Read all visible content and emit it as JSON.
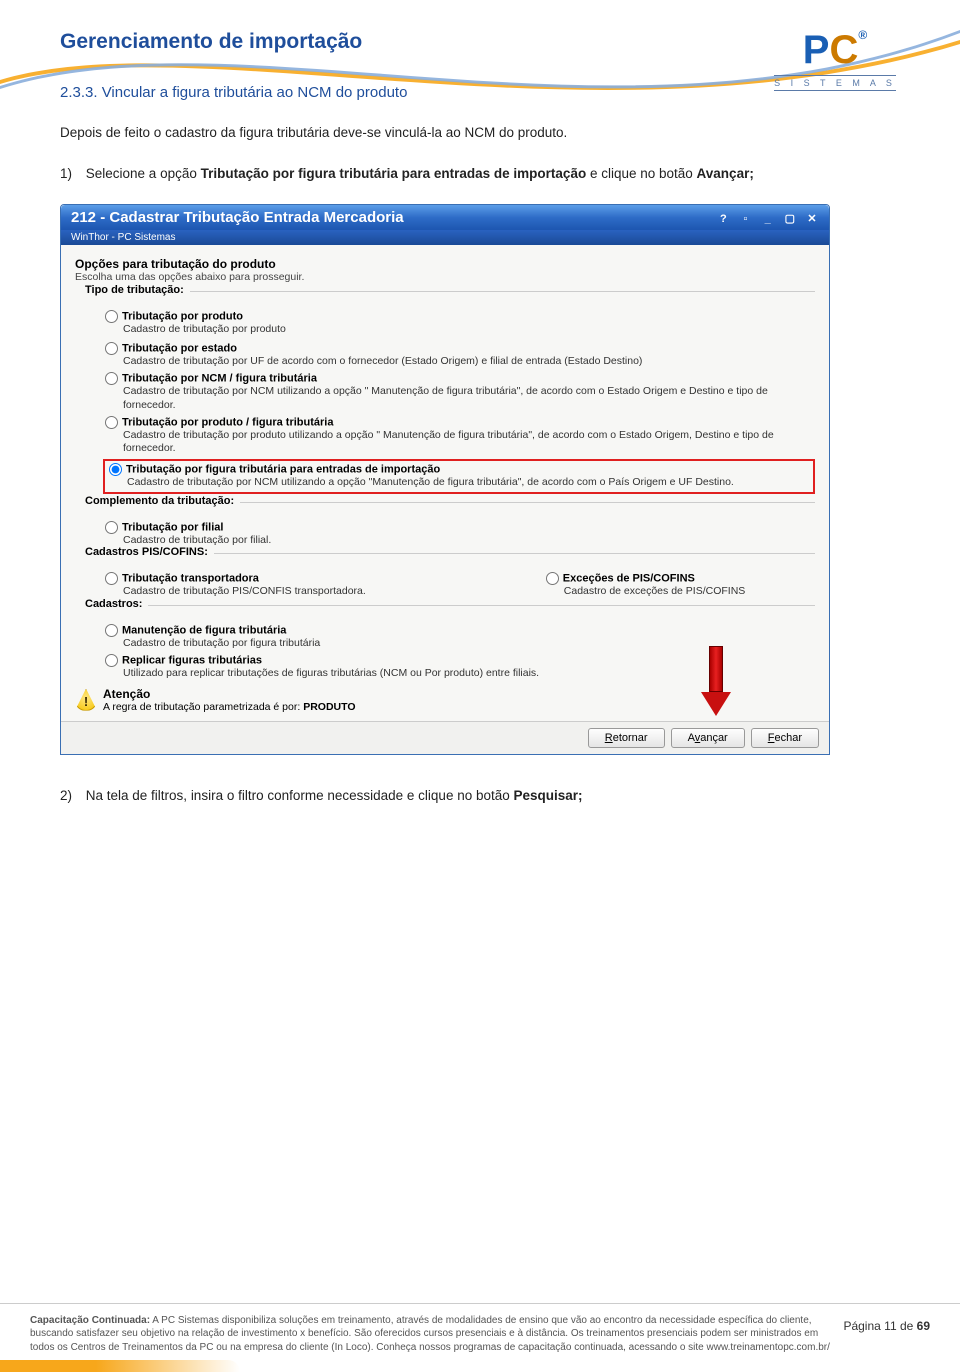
{
  "doc": {
    "title": "Gerenciamento de importação",
    "section_number": "2.3.3.",
    "section_title": "Vincular a figura tributária ao NCM do produto",
    "intro": "Depois de feito o cadastro da figura tributária deve-se vinculá-la ao NCM do produto.",
    "step1_num": "1)",
    "step1_a": "Selecione a opção ",
    "step1_b": "Tributação por figura tributária para entradas de importação",
    "step1_c": " e clique no botão ",
    "step1_d": "Avançar;",
    "step2_num": "2)",
    "step2_a": "Na tela de filtros, insira o filtro conforme necessidade e clique no botão ",
    "step2_b": "Pesquisar;"
  },
  "win": {
    "title": "212 - Cadastrar Tributação Entrada Mercadoria",
    "subtitle": "WinThor - PC Sistemas",
    "opt_h": "Opções para tributação do produto",
    "opt_sub": "Escolha uma das opções abaixo para prosseguir.",
    "grp_tipo": "Tipo de tributação:",
    "radios_tipo": [
      {
        "label": "Tributação por produto",
        "desc": "Cadastro de tributação por produto"
      },
      {
        "label": "Tributação por estado",
        "desc": "Cadastro de tributação por UF de acordo com o fornecedor (Estado Origem) e filial de entrada (Estado Destino)"
      },
      {
        "label": "Tributação por NCM / figura tributária",
        "desc": "Cadastro de tributação por NCM utilizando a opção \" Manutenção de figura tributária\", de acordo com o Estado Origem e Destino e tipo de fornecedor."
      },
      {
        "label": "Tributação por produto / figura tributária",
        "desc": "Cadastro de tributação por produto utilizando a opção \" Manutenção de figura tributária\", de acordo com o Estado Origem, Destino e tipo de fornecedor."
      },
      {
        "label": "Tributação por figura tributária para entradas de importação",
        "desc": "Cadastro de tributação por NCM utilizando a opção \"Manutenção de figura tributária\", de acordo com o País Origem e UF Destino.",
        "selected": true,
        "highlight": true
      }
    ],
    "grp_compl": "Complemento da tributação:",
    "radios_compl": [
      {
        "label": "Tributação por filial",
        "desc": "Cadastro de tributação por filial."
      }
    ],
    "grp_pis": "Cadastros PIS/COFINS:",
    "radios_pis_left": {
      "label": "Tributação transportadora",
      "desc": "Cadastro de tributação PIS/CONFIS transportadora."
    },
    "radios_pis_right": {
      "label": "Exceções de PIS/COFINS",
      "desc": "Cadastro de exceções de PIS/COFINS"
    },
    "grp_cad": "Cadastros:",
    "radios_cad": [
      {
        "label": "Manutenção de figura tributária",
        "desc": "Cadastro de tributação por figura tributária"
      },
      {
        "label": "Replicar figuras tributárias",
        "desc": "Utilizado para replicar tributações de figuras tributárias (NCM ou Por produto) entre filiais."
      }
    ],
    "atencao": "Atenção",
    "atencao_desc_a": "A regra de tributação parametrizada é por: ",
    "atencao_desc_b": "PRODUTO",
    "btn_retornar": "Retornar",
    "btn_avancar": "Avançar",
    "btn_fechar": "Fechar"
  },
  "footer": {
    "bold": "Capacitação Continuada:",
    "text": " A PC Sistemas disponibiliza soluções em treinamento, através de modalidades de ensino que vão ao encontro da necessidade específica do cliente, buscando satisfazer seu objetivo na relação de investimento x benefício. São oferecidos cursos presenciais e à distância. Os treinamentos presenciais podem ser ministrados em todos os Centros de Treinamentos da PC ou na empresa do cliente (In Loco). Conheça nossos programas de capacitação continuada, acessando o site www.treinamentopc.com.br/",
    "page_a": "Página ",
    "page_b": "11",
    "page_c": " de ",
    "page_d": "69"
  },
  "logo": {
    "brand": "PC",
    "tag": "S I S T E M A S"
  }
}
